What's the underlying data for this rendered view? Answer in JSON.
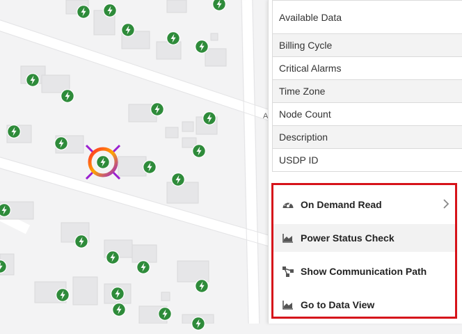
{
  "info_table": {
    "rows": [
      {
        "label": "Available Data"
      },
      {
        "label": "Billing Cycle"
      },
      {
        "label": "Critical Alarms"
      },
      {
        "label": "Time Zone"
      },
      {
        "label": "Node Count"
      },
      {
        "label": "Description"
      },
      {
        "label": "USDP ID"
      }
    ]
  },
  "context_menu": {
    "items": [
      {
        "label": "On Demand Read",
        "icon": "gauge-icon",
        "has_submenu": true
      },
      {
        "label": "Power Status Check",
        "icon": "area-chart-icon",
        "has_submenu": false
      },
      {
        "label": "Show Communication Path",
        "icon": "network-path-icon",
        "has_submenu": false
      },
      {
        "label": "Go to Data View",
        "icon": "area-chart-icon",
        "has_submenu": false
      }
    ]
  },
  "map": {
    "street_label": "A",
    "marker_color": "#2e8b3a",
    "selection_ring_colors": [
      "#ff2a2a",
      "#ffa600",
      "#9a1fd0"
    ]
  },
  "colors": {
    "highlight_border": "#d6131a"
  }
}
